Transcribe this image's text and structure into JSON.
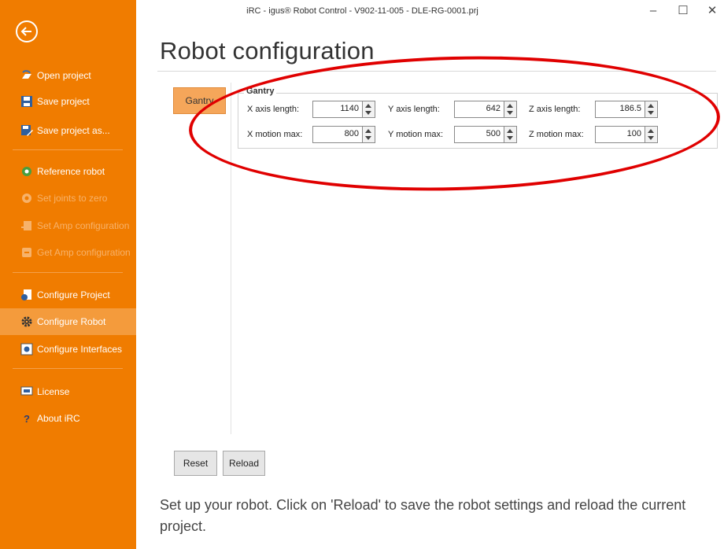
{
  "window": {
    "title": "iRC - igus® Robot Control - V902-11-005 - DLE-RG-0001.prj",
    "minimize": "–",
    "maximize": "☐",
    "close": "✕"
  },
  "sidebar": {
    "items": [
      {
        "label": "Open project",
        "icon": "open-folder-icon"
      },
      {
        "label": "Save project",
        "icon": "save-icon"
      },
      {
        "label": "Save project as...",
        "icon": "save-as-icon"
      },
      {
        "label": "Reference robot",
        "icon": "reference-icon"
      },
      {
        "label": "Set joints to zero",
        "icon": "zero-joints-icon",
        "disabled": true
      },
      {
        "label": "Set Amp configuration",
        "icon": "set-amp-icon",
        "disabled": true
      },
      {
        "label": "Get Amp configuration",
        "icon": "get-amp-icon",
        "disabled": true
      },
      {
        "label": "Configure Project",
        "icon": "configure-project-icon"
      },
      {
        "label": "Configure Robot",
        "icon": "gear-icon",
        "selected": true
      },
      {
        "label": "Configure Interfaces",
        "icon": "interfaces-icon"
      },
      {
        "label": "License",
        "icon": "license-icon"
      },
      {
        "label": "About iRC",
        "icon": "question-icon"
      }
    ]
  },
  "page": {
    "title": "Robot configuration",
    "tab": "Gantry",
    "group_title": "Gantry",
    "fields": {
      "x_axis_length": {
        "label": "X axis length:",
        "value": "1140"
      },
      "y_axis_length": {
        "label": "Y axis length:",
        "value": "642"
      },
      "z_axis_length": {
        "label": "Z axis length:",
        "value": "186.5"
      },
      "x_motion_max": {
        "label": "X motion max:",
        "value": "800"
      },
      "y_motion_max": {
        "label": "Y motion max:",
        "value": "500"
      },
      "z_motion_max": {
        "label": "Z motion max:",
        "value": "100"
      }
    },
    "buttons": {
      "reset": "Reset",
      "reload": "Reload"
    },
    "description": "Set up your robot. Click on 'Reload' to save the robot settings and reload the current project."
  },
  "colors": {
    "sidebar": "#f07c00",
    "selected_item": "#f49b3c",
    "tab": "#f5a65a",
    "annotation": "#e00000"
  }
}
